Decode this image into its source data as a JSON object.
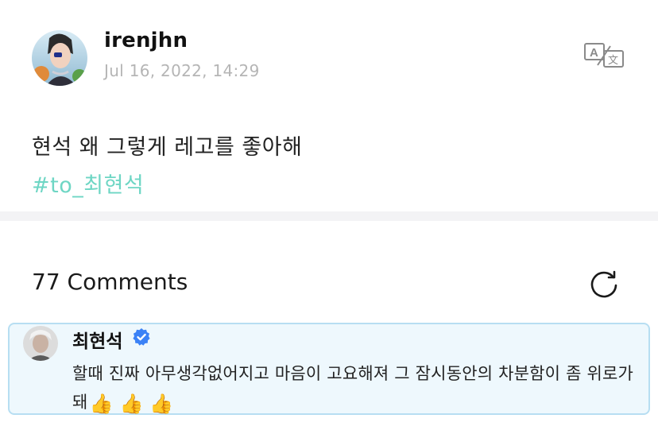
{
  "post": {
    "username": "irenjhn",
    "timestamp": "Jul 16, 2022, 14:29",
    "text": "현석 왜 그렇게 레고를 좋아해",
    "hashtag": "#to_최현석",
    "translate_icon": "translate-icon"
  },
  "comments": {
    "count_label": "77 Comments",
    "refresh_icon": "refresh-icon",
    "items": [
      {
        "author": "최현석",
        "verified": true,
        "text": "할때 진짜 아무생각없어지고 마음이 고요해져 그 잠시동안의 차분함이 좀 위로가 돼",
        "emojis": "👍 👍 👍"
      }
    ]
  },
  "colors": {
    "hashtag": "#6ed6c4",
    "timestamp": "#b5b5b5",
    "comment_bg": "#eef8fd",
    "comment_border": "#b7def2",
    "verified": "#3b82f6"
  }
}
